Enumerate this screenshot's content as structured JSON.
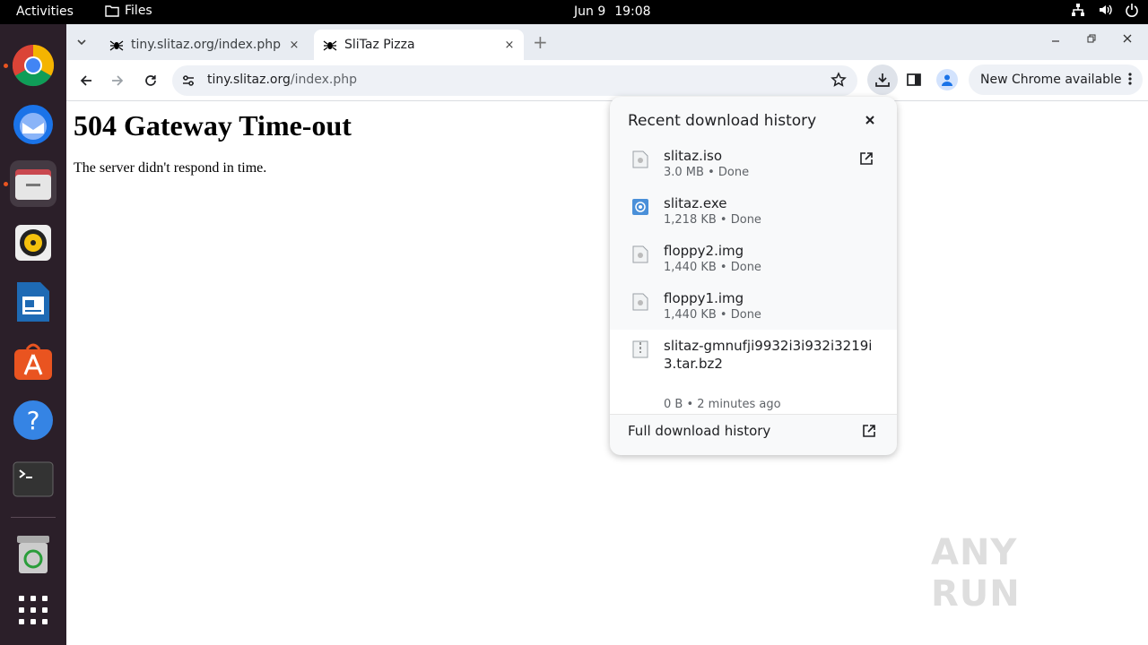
{
  "topbar": {
    "activities": "Activities",
    "files_app": "Files",
    "date": "Jun 9",
    "time": "19:08"
  },
  "dock": {
    "items": [
      "chrome",
      "thunderbird",
      "files",
      "rhythmbox",
      "libreoffice-writer",
      "app-center",
      "help",
      "terminal",
      "trash",
      "show-apps"
    ]
  },
  "browser": {
    "tabs": [
      {
        "title": "tiny.slitaz.org/index.php",
        "close": "×"
      },
      {
        "title": "SliTaz Pizza",
        "close": "×"
      }
    ],
    "new_tab": "+",
    "url_host": "tiny.slitaz.org",
    "url_path": "/index.php",
    "update_chip": "New Chrome available"
  },
  "page": {
    "heading": "504 Gateway Time-out",
    "message": "The server didn't respond in time."
  },
  "downloads": {
    "title": "Recent download history",
    "items": [
      {
        "name": "slitaz.iso",
        "meta": "3.0 MB • Done",
        "icon": "file-icon"
      },
      {
        "name": "slitaz.exe",
        "meta": "1,218 KB • Done",
        "icon": "exe-icon"
      },
      {
        "name": "floppy2.img",
        "meta": "1,440 KB • Done",
        "icon": "file-icon"
      },
      {
        "name": "floppy1.img",
        "meta": "1,440 KB • Done",
        "icon": "file-icon"
      },
      {
        "name": "slitaz-gmnufji9932i3i932i3219i3.tar.bz2",
        "meta": "0 B • 2 minutes ago",
        "icon": "archive-icon"
      }
    ],
    "full_history": "Full download history"
  },
  "watermark": "ANY RUN",
  "colors": {
    "dock_bg": "#2b1f29",
    "accent": "#e95420",
    "tabstrip_bg": "#e8ecf2"
  }
}
